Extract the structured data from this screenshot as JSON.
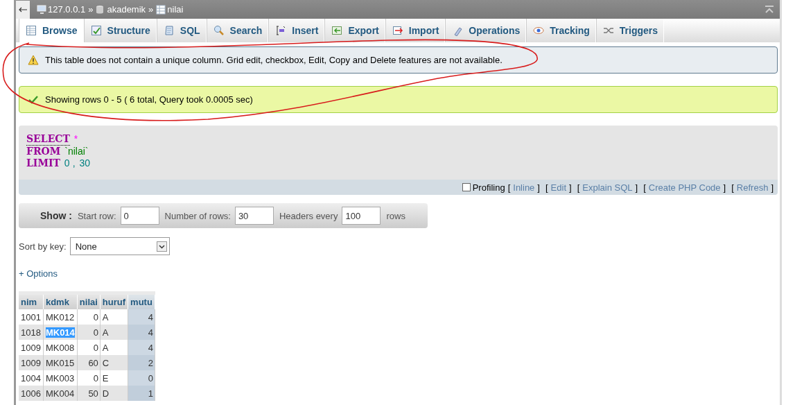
{
  "breadcrumb": [
    {
      "label": "127.0.0.1",
      "separator": "»"
    },
    {
      "label": "akademik",
      "separator": "»"
    },
    {
      "label": "nilai"
    }
  ],
  "tabs": [
    {
      "label": "Browse",
      "selected": true
    },
    {
      "label": "Structure",
      "selected": false
    },
    {
      "label": "SQL",
      "selected": false
    },
    {
      "label": "Search",
      "selected": false
    },
    {
      "label": "Insert",
      "selected": false
    },
    {
      "label": "Export",
      "selected": false
    },
    {
      "label": "Import",
      "selected": false
    },
    {
      "label": "Operations",
      "selected": false
    },
    {
      "label": "Tracking",
      "selected": false
    },
    {
      "label": "Triggers",
      "selected": false
    }
  ],
  "messages": [
    {
      "kind": "notice",
      "text": "This table does not contain a unique column. Grid edit, checkbox, Edit, Copy and Delete features are not available."
    },
    {
      "kind": "success",
      "text": "Showing rows 0 - 5 ( 6 total, Query took 0.0005 sec)"
    }
  ],
  "sql": {
    "lines": [
      [
        {
          "kind": "keyword",
          "text": "SELECT"
        },
        {
          "kind": "operator",
          "text": "*"
        }
      ],
      [
        {
          "kind": "keyword",
          "text": "FROM"
        },
        {
          "kind": "identifier",
          "text": "`nilai`"
        }
      ],
      [
        {
          "kind": "keyword",
          "text": "LIMIT"
        },
        {
          "kind": "number",
          "text": "0"
        },
        {
          "kind": "punctuation",
          "text": ","
        },
        {
          "kind": "number",
          "text": "30"
        }
      ]
    ],
    "profiling": {
      "label": "Profiling",
      "checked": false
    },
    "links": [
      {
        "open": "[",
        "text": "Inline",
        "close": "]"
      },
      {
        "open": "[",
        "text": "Edit",
        "close": "]"
      },
      {
        "open": "[",
        "text": "Explain SQL",
        "close": "]"
      },
      {
        "open": "[",
        "text": "Create PHP Code",
        "close": "]"
      },
      {
        "open": "[",
        "text": "Refresh",
        "close": "]"
      }
    ]
  },
  "show_form": {
    "title": "Show :",
    "fields": [
      {
        "label": "Start row:",
        "value": "0"
      },
      {
        "label": "Number of rows:",
        "value": "30"
      },
      {
        "label": "Headers every",
        "value": "100"
      }
    ],
    "suffix": "rows"
  },
  "sort_by": {
    "label": "Sort by key:",
    "value": "None"
  },
  "options_link": "+ Options",
  "table": {
    "columns": [
      {
        "name": "nim",
        "numeric": false,
        "sorted": false
      },
      {
        "name": "kdmk",
        "numeric": false,
        "sorted": false
      },
      {
        "name": "nilai",
        "numeric": true,
        "sorted": false
      },
      {
        "name": "huruf",
        "numeric": false,
        "sorted": false
      },
      {
        "name": "mutu",
        "numeric": true,
        "sorted": true
      }
    ],
    "rows": [
      {
        "cells": [
          {
            "text": "1001",
            "selected": false
          },
          {
            "text": "MK012",
            "selected": false
          },
          {
            "text": "0",
            "selected": false
          },
          {
            "text": "A",
            "selected": false
          },
          {
            "text": "4",
            "selected": false
          }
        ]
      },
      {
        "cells": [
          {
            "text": "1018",
            "selected": false
          },
          {
            "text": "MK014",
            "selected": true
          },
          {
            "text": "0",
            "selected": false
          },
          {
            "text": "A",
            "selected": false
          },
          {
            "text": "4",
            "selected": false
          }
        ]
      },
      {
        "cells": [
          {
            "text": "1009",
            "selected": false
          },
          {
            "text": "MK008",
            "selected": false
          },
          {
            "text": "0",
            "selected": false
          },
          {
            "text": "A",
            "selected": false
          },
          {
            "text": "4",
            "selected": false
          }
        ]
      },
      {
        "cells": [
          {
            "text": "1009",
            "selected": false
          },
          {
            "text": "MK015",
            "selected": false
          },
          {
            "text": "60",
            "selected": false
          },
          {
            "text": "C",
            "selected": false
          },
          {
            "text": "2",
            "selected": false
          }
        ]
      },
      {
        "cells": [
          {
            "text": "1004",
            "selected": false
          },
          {
            "text": "MK003",
            "selected": false
          },
          {
            "text": "0",
            "selected": false
          },
          {
            "text": "E",
            "selected": false
          },
          {
            "text": "0",
            "selected": false
          }
        ]
      },
      {
        "cells": [
          {
            "text": "1006",
            "selected": false
          },
          {
            "text": "MK004",
            "selected": false
          },
          {
            "text": "50",
            "selected": false
          },
          {
            "text": "D",
            "selected": false
          },
          {
            "text": "1",
            "selected": false
          }
        ]
      }
    ]
  }
}
